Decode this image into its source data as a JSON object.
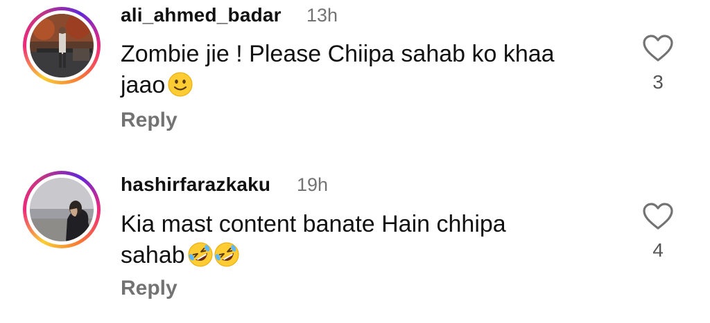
{
  "comments": [
    {
      "username": "ali_ahmed_badar",
      "time": "13h",
      "text_line1": "Zombie jie ! Please Chiipa sahab ko khaa",
      "text_line2": "jaao",
      "emojis": [
        "slightly-smiling-face"
      ],
      "reply_label": "Reply",
      "like_count": "3",
      "icon": "heart-outline-icon"
    },
    {
      "username": "hashirfarazkaku",
      "time": "19h",
      "text_line1": "Kia mast content banate Hain chhipa",
      "text_line2": "sahab",
      "emojis": [
        "rolling-on-floor-laughing",
        "rolling-on-floor-laughing"
      ],
      "reply_label": "Reply",
      "like_count": "4",
      "icon": "heart-outline-icon"
    }
  ],
  "colors": {
    "text": "#111111",
    "muted": "#737373",
    "ring_gradient": [
      "#f9ce34",
      "#ee2a7b",
      "#6228d7"
    ]
  }
}
